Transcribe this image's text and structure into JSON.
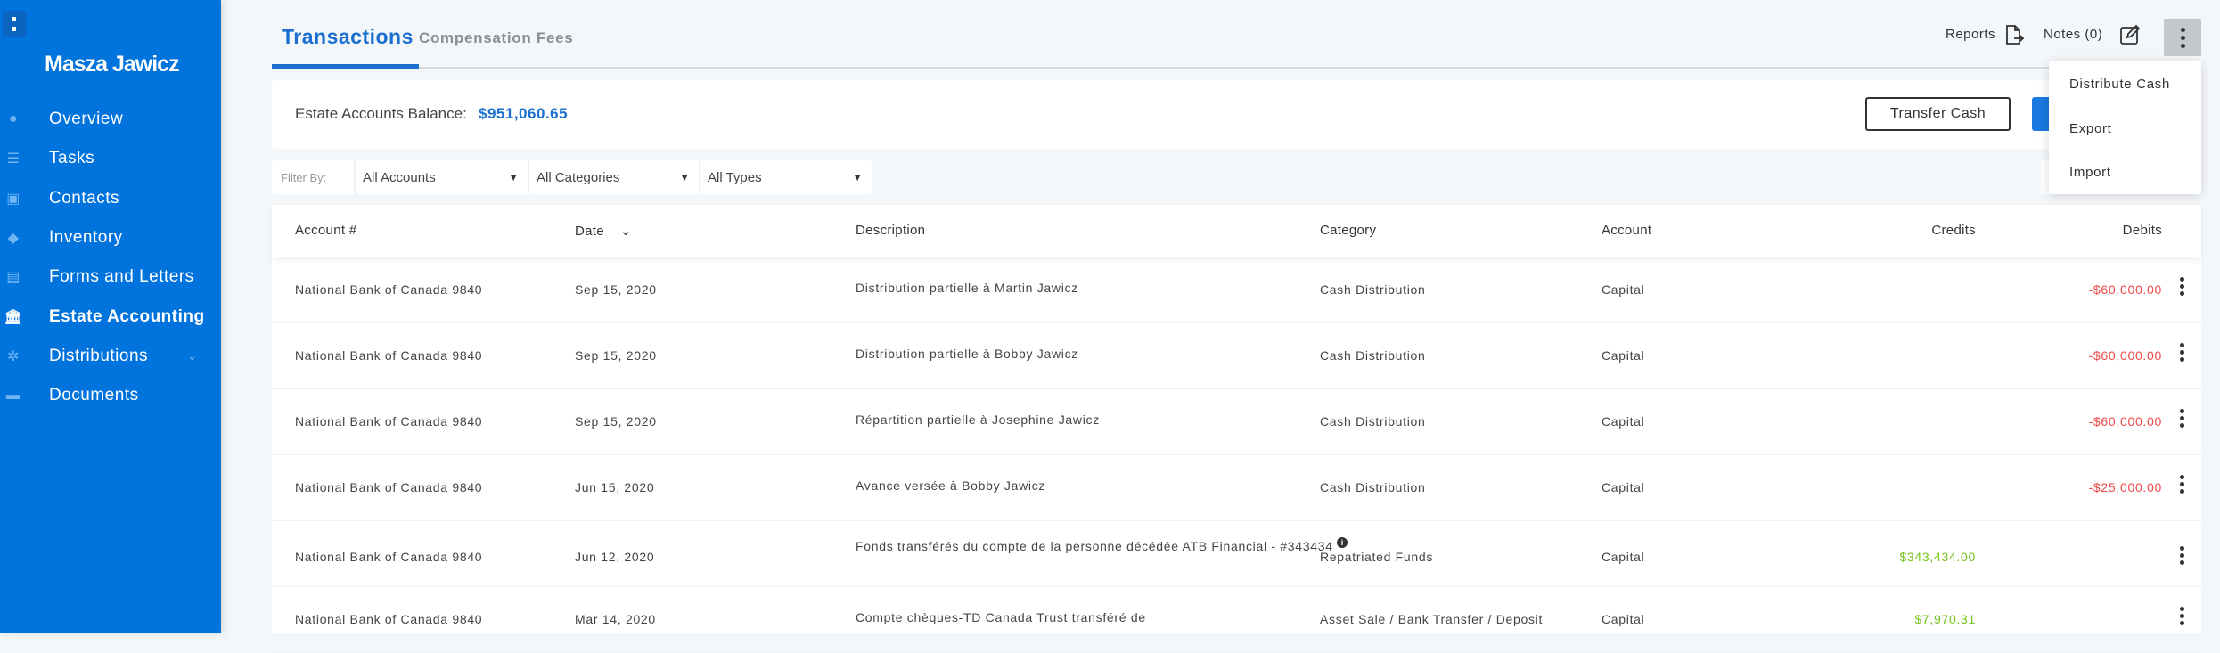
{
  "sidebar": {
    "user_name": "Masza Jawicz",
    "items": [
      {
        "label": "Overview",
        "icon": "clock-icon"
      },
      {
        "label": "Tasks",
        "icon": "list-icon"
      },
      {
        "label": "Contacts",
        "icon": "contact-card-icon"
      },
      {
        "label": "Inventory",
        "icon": "box-icon"
      },
      {
        "label": "Forms and Letters",
        "icon": "document-edit-icon"
      },
      {
        "label": "Estate Accounting",
        "icon": "bank-icon",
        "active": true
      },
      {
        "label": "Distributions",
        "icon": "network-icon",
        "has_submenu": true
      },
      {
        "label": "Documents",
        "icon": "folder-icon"
      }
    ]
  },
  "tabs": [
    {
      "label": "Transactions",
      "active": true
    },
    {
      "label": "Compensation Fees"
    }
  ],
  "toolbar": {
    "reports": "Reports",
    "notes": "Notes (0)"
  },
  "balance": {
    "label": "Estate Accounts Balance:",
    "value": "$951,060.65"
  },
  "buttons": {
    "transfer_cash": "Transfer Cash"
  },
  "filters": {
    "label": "Filter By:",
    "accounts": "All Accounts",
    "categories": "All Categories",
    "types": "All Types"
  },
  "table": {
    "headers": [
      "Account #",
      "Date",
      "Description",
      "Category",
      "Account",
      "Credits",
      "Debits"
    ],
    "rows": [
      {
        "account_no": "National Bank of Canada 9840",
        "date": "Sep 15, 2020",
        "description": "Distribution partielle à Martin Jawicz",
        "category": "Cash Distribution",
        "account": "Capital",
        "credit": "",
        "debit": "-$60,000.00"
      },
      {
        "account_no": "National Bank of Canada 9840",
        "date": "Sep 15, 2020",
        "description": "Distribution partielle à Bobby Jawicz",
        "category": "Cash Distribution",
        "account": "Capital",
        "credit": "",
        "debit": "-$60,000.00"
      },
      {
        "account_no": "National Bank of Canada 9840",
        "date": "Sep 15, 2020",
        "description": "Répartition partielle à Josephine Jawicz",
        "category": "Cash Distribution",
        "account": "Capital",
        "credit": "",
        "debit": "-$60,000.00"
      },
      {
        "account_no": "National Bank of Canada 9840",
        "date": "Jun 15, 2020",
        "description": "Avance versée à Bobby Jawicz",
        "category": "Cash Distribution",
        "account": "Capital",
        "credit": "",
        "debit": "-$25,000.00"
      },
      {
        "account_no": "National Bank of Canada 9840",
        "date": "Jun 12, 2020",
        "description": "Fonds transférés du compte de la personne décédée ATB Financial - #343434",
        "category": "Repatriated Funds",
        "account": "Capital",
        "credit": "$343,434.00",
        "debit": "",
        "info": true
      },
      {
        "account_no": "National Bank of Canada 9840",
        "date": "Mar 14, 2020",
        "description": "Compte chèques-TD Canada Trust transféré de",
        "category": "Asset Sale / Bank Transfer / Deposit",
        "account": "Capital",
        "credit": "$7,970.31",
        "debit": ""
      }
    ]
  },
  "dropdown_menu": [
    "Distribute Cash",
    "Export",
    "Import"
  ],
  "colors": {
    "sidebar": "#0073dd",
    "accent": "#1a6fd0",
    "debit": "#f04848",
    "credit": "#73c21a"
  }
}
